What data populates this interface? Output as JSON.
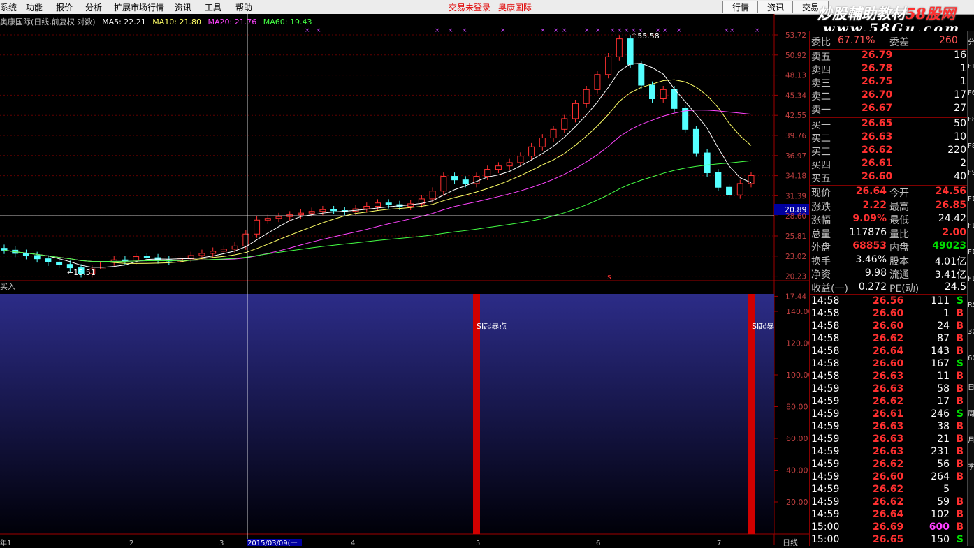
{
  "menu": {
    "items": [
      "系统",
      "功能",
      "报价",
      "分析",
      "扩展市场行情",
      "资讯",
      "工具",
      "帮助"
    ],
    "trade_status": "交易未登录",
    "broker": "奥康国际",
    "tabs": [
      "行情",
      "资讯",
      "交易"
    ]
  },
  "watermark": {
    "line1_a": "炒股輔助教材",
    "line1_b": "58股网",
    "line2": "www.58Gu.com"
  },
  "main_chart": {
    "title": "奥康国际(日线,前复权 对数)",
    "ma5": "MA5: 22.21",
    "ma10": "MA10: 21.80",
    "ma20": "MA20: 21.76",
    "ma60": "MA60: 19.43",
    "ma_colors": {
      "ma5": "#ffffff",
      "ma10": "#ffff66",
      "ma20": "#ff44ff",
      "ma60": "#44ff44"
    },
    "high_label": "55.58",
    "low_label": "15.51",
    "current_price_tag": "20.89",
    "price_ticks": [
      "53.72",
      "50.92",
      "48.13",
      "45.34",
      "42.55",
      "39.76",
      "36.97",
      "34.18",
      "31.39",
      "28.60",
      "25.81",
      "23.02",
      "20.23",
      "17.44"
    ]
  },
  "chart_data": {
    "type": "candlestick",
    "title": "奥康国际(日线,前复权 对数)",
    "y_axis_ticks": [
      53.72,
      50.92,
      48.13,
      45.34,
      42.55,
      39.76,
      36.97,
      34.18,
      31.39,
      28.6,
      25.81,
      23.02,
      20.23,
      17.44
    ],
    "low": 15.51,
    "high": 55.58,
    "marker_line": 20.89,
    "closes_approx": [
      17.9,
      17.6,
      17.4,
      17.1,
      16.8,
      16.6,
      16.3,
      15.8,
      16.2,
      16.8,
      17.0,
      16.9,
      17.3,
      17.2,
      17.0,
      16.9,
      17.1,
      17.4,
      17.6,
      17.8,
      18.0,
      18.3,
      19.5,
      21.0,
      21.2,
      21.4,
      21.6,
      21.8,
      22.0,
      22.2,
      22.1,
      22.0,
      22.3,
      22.6,
      23.0,
      22.8,
      22.6,
      22.9,
      23.5,
      24.5,
      26.5,
      26.0,
      25.5,
      26.5,
      27.5,
      28.0,
      28.5,
      29.5,
      31.0,
      32.5,
      34.0,
      36.0,
      39.0,
      42.0,
      45.5,
      50.0,
      55.0,
      48.0,
      43.0,
      40.0,
      42.0,
      38.0,
      34.0,
      30.0,
      27.0,
      25.0,
      24.0,
      25.5,
      26.6
    ]
  },
  "indicator": {
    "title": "买入",
    "label1": "SI起暴点",
    "label2": "SI起暴",
    "ticks": [
      "140.00",
      "120.00",
      "100.00",
      "80.00",
      "60.00",
      "40.00",
      "20.00"
    ],
    "values": [
      {
        "date": "5",
        "value": 150
      },
      {
        "date": "7",
        "value": 150
      }
    ]
  },
  "date_axis": {
    "cursor_date": "2015/03/09(一",
    "months": [
      "年1",
      "2",
      "3",
      "4",
      "5",
      "6",
      "7"
    ],
    "period": "日线"
  },
  "quote": {
    "weibi_label": "委比",
    "weibi": "67.71%",
    "weicha_label": "委差",
    "weicha": "260",
    "asks": [
      {
        "label": "卖五",
        "price": "26.79",
        "vol": "16"
      },
      {
        "label": "卖四",
        "price": "26.78",
        "vol": "1"
      },
      {
        "label": "卖三",
        "price": "26.75",
        "vol": "1"
      },
      {
        "label": "卖二",
        "price": "26.70",
        "vol": "17"
      },
      {
        "label": "卖一",
        "price": "26.67",
        "vol": "27"
      }
    ],
    "bids": [
      {
        "label": "买一",
        "price": "26.65",
        "vol": "50"
      },
      {
        "label": "买二",
        "price": "26.63",
        "vol": "10"
      },
      {
        "label": "买三",
        "price": "26.62",
        "vol": "220"
      },
      {
        "label": "买四",
        "price": "26.61",
        "vol": "2"
      },
      {
        "label": "买五",
        "price": "26.60",
        "vol": "40"
      }
    ],
    "stats": [
      {
        "l1": "现价",
        "v1": "26.64",
        "c1": "red",
        "l2": "今开",
        "v2": "24.56",
        "c2": "red"
      },
      {
        "l1": "涨跌",
        "v1": "2.22",
        "c1": "red",
        "l2": "最高",
        "v2": "26.85",
        "c2": "red"
      },
      {
        "l1": "涨幅",
        "v1": "9.09%",
        "c1": "red",
        "l2": "最低",
        "v2": "24.42",
        "c2": "white"
      },
      {
        "l1": "总量",
        "v1": "117876",
        "c1": "white",
        "l2": "量比",
        "v2": "2.00",
        "c2": "red"
      },
      {
        "l1": "外盘",
        "v1": "68853",
        "c1": "red",
        "l2": "内盘",
        "v2": "49023",
        "c2": "green"
      },
      {
        "l1": "换手",
        "v1": "3.46%",
        "c1": "white",
        "l2": "股本",
        "v2": "4.01亿",
        "c2": "white"
      },
      {
        "l1": "净资",
        "v1": "9.98",
        "c1": "white",
        "l2": "流通",
        "v2": "3.41亿",
        "c2": "white"
      },
      {
        "l1": "收益(一)",
        "v1": "0.272",
        "c1": "white",
        "l2": "PE(动)",
        "v2": "24.5",
        "c2": "white"
      }
    ],
    "ticks": [
      {
        "t": "14:58",
        "p": "26.56",
        "v": "111",
        "s": "S"
      },
      {
        "t": "14:58",
        "p": "26.60",
        "v": "1",
        "s": "B"
      },
      {
        "t": "14:58",
        "p": "26.60",
        "v": "24",
        "s": "B"
      },
      {
        "t": "14:58",
        "p": "26.62",
        "v": "87",
        "s": "B"
      },
      {
        "t": "14:58",
        "p": "26.64",
        "v": "143",
        "s": "B"
      },
      {
        "t": "14:58",
        "p": "26.60",
        "v": "167",
        "s": "S"
      },
      {
        "t": "14:58",
        "p": "26.63",
        "v": "11",
        "s": "B"
      },
      {
        "t": "14:59",
        "p": "26.63",
        "v": "58",
        "s": "B"
      },
      {
        "t": "14:59",
        "p": "26.62",
        "v": "17",
        "s": "B"
      },
      {
        "t": "14:59",
        "p": "26.61",
        "v": "246",
        "s": "S"
      },
      {
        "t": "14:59",
        "p": "26.63",
        "v": "38",
        "s": "B"
      },
      {
        "t": "14:59",
        "p": "26.63",
        "v": "21",
        "s": "B"
      },
      {
        "t": "14:59",
        "p": "26.63",
        "v": "231",
        "s": "B"
      },
      {
        "t": "14:59",
        "p": "26.62",
        "v": "56",
        "s": "B"
      },
      {
        "t": "14:59",
        "p": "26.60",
        "v": "264",
        "s": "B"
      },
      {
        "t": "14:59",
        "p": "26.62",
        "v": "5",
        "s": ""
      },
      {
        "t": "14:59",
        "p": "26.62",
        "v": "59",
        "s": "B"
      },
      {
        "t": "14:59",
        "p": "26.64",
        "v": "102",
        "s": "B"
      },
      {
        "t": "15:00",
        "p": "26.69",
        "v": "600",
        "s": "B"
      },
      {
        "t": "15:00",
        "p": "26.65",
        "v": "150",
        "s": "S"
      }
    ]
  },
  "side_strip": [
    "分",
    "F1",
    "F6",
    "F8",
    "F8",
    "F9",
    "F1",
    "F1",
    "F1",
    "F1",
    "RS",
    "30",
    "60",
    "日",
    "周",
    "月",
    "季"
  ]
}
